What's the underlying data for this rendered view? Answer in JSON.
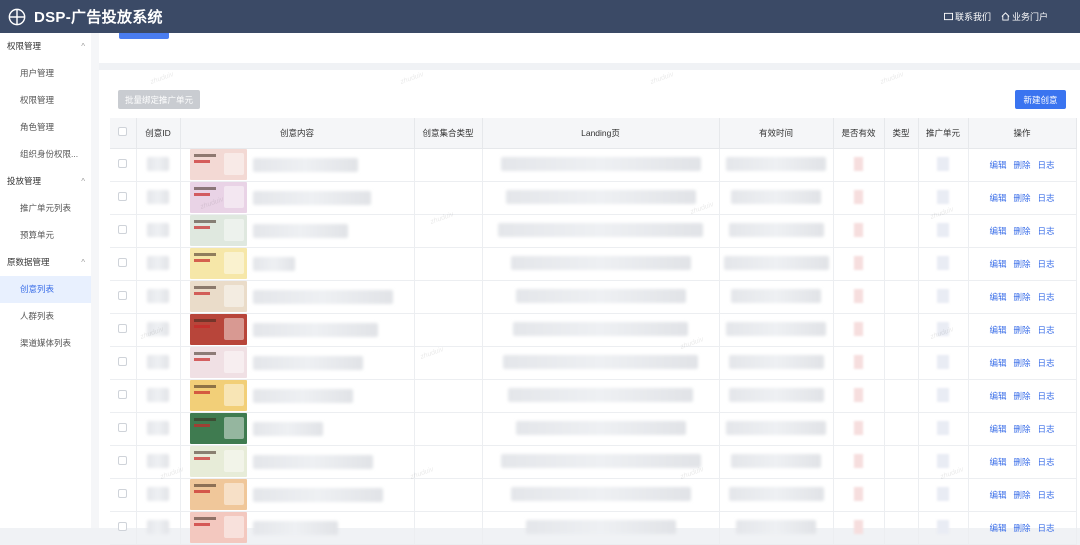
{
  "app": {
    "title": "DSP-广告投放系统"
  },
  "header": {
    "contact_label": "联系我们",
    "portal_label": "业务门户"
  },
  "sidebar": {
    "groups": [
      {
        "label": "权限管理",
        "items": [
          "用户管理",
          "权限管理",
          "角色管理",
          "组织身份权限..."
        ]
      },
      {
        "label": "投放管理",
        "items": [
          "推广单元列表",
          "预算单元"
        ]
      },
      {
        "label": "原数据管理",
        "items": [
          "创意列表",
          "人群列表",
          "渠道媒体列表"
        ]
      }
    ],
    "active_item": "创意列表"
  },
  "toolbar": {
    "batch_bind_label": "批量绑定推广单元",
    "new_creative_label": "新建创意"
  },
  "table": {
    "columns": [
      "",
      "创意ID",
      "创意内容",
      "创意集合类型",
      "Landing页",
      "有效时间",
      "是否有效",
      "类型",
      "推广单元",
      "操作"
    ],
    "row_count": 12,
    "actions": {
      "edit": "编辑",
      "delete": "删除",
      "log": "日志"
    }
  },
  "watermark": "zhuduiv",
  "colors": {
    "topbar": "#3b4a66",
    "accent": "#3a74f0",
    "active_bg": "#e8f0fe"
  }
}
